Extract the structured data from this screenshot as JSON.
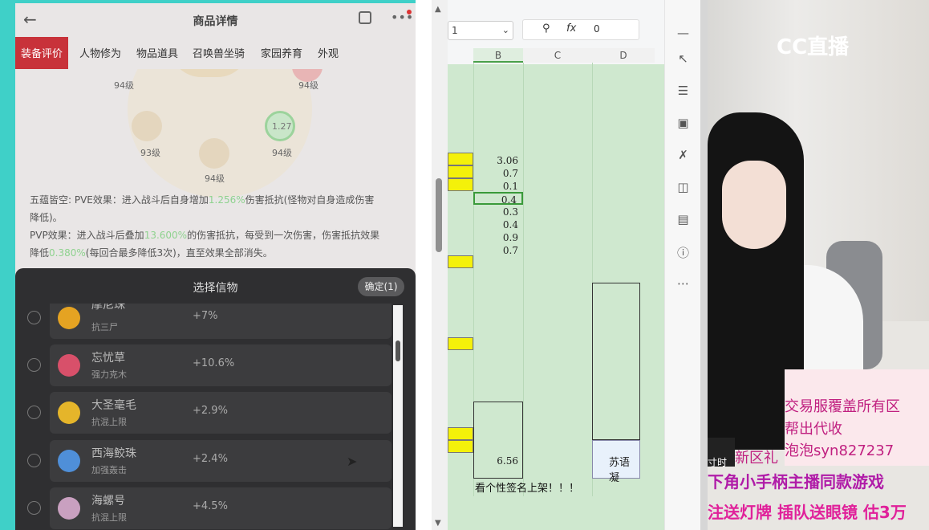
{
  "phone": {
    "title": "商品详情",
    "tabs": [
      "装备评价",
      "人物修为",
      "物品道具",
      "召唤兽坐骑",
      "家园养育",
      "外观"
    ],
    "levels": [
      "94级",
      "94级",
      "93级",
      "94级",
      "94级"
    ],
    "node_value": "1.27",
    "desc1": "五蕴皆空: PVE效果：进入战斗后自身增加",
    "desc1_hl": "1.256%",
    "desc1_tail": "伤害抵抗(怪物对自身造成伤害",
    "desc1_line2": "降低)。",
    "desc2": "PVP效果：进入战斗后叠加",
    "desc2_hl": "13.600%",
    "desc2_tail": "的伤害抵抗，每受到一次伤害，伤害抵抗效果",
    "desc3": "降低",
    "desc3_hl": "0.380%",
    "desc3_tail": "(每回合最多降低3次)，直至效果全部消失。"
  },
  "sheet_panel": {
    "title": "选择信物",
    "confirm": "确定(1)",
    "items": [
      {
        "name": "摩尼珠",
        "sub": "抗三尸",
        "value": "+7%",
        "color": "#e5a322"
      },
      {
        "name": "忘忧草",
        "sub": "强力克木",
        "value": "+10.6%",
        "color": "#d8506a"
      },
      {
        "name": "大圣毫毛",
        "sub": "抗混上限",
        "value": "+2.9%",
        "color": "#e5b52a"
      },
      {
        "name": "西海鲛珠",
        "sub": "加强轰击",
        "value": "+2.4%",
        "color": "#4f8fd8"
      },
      {
        "name": "海螺号",
        "sub": "抗混上限",
        "value": "+4.5%",
        "color": "#c9a0c0"
      }
    ]
  },
  "spreadsheet": {
    "namebox": "1",
    "fx_label": "fx",
    "fx_value": "0",
    "columns": [
      "B",
      "C",
      "D"
    ],
    "values": [
      "3.06",
      "0.7",
      "0.1",
      "0.4",
      "0.3",
      "0.4",
      "0.9",
      "0.7"
    ],
    "value_656": "6.56",
    "note": "看个性签名上架！！！",
    "su_text": "苏语凝"
  },
  "stream": {
    "logo": "CC直播",
    "banner_lines": [
      "交易服覆盖所有区",
      "帮出代收",
      "泡泡syn827237"
    ],
    "new_area": "新区礼",
    "time_label": "寸时",
    "ticker1": "下角小手柄主播同款游戏",
    "ticker2": "注送灯牌  插队送眼镜  估3万"
  }
}
